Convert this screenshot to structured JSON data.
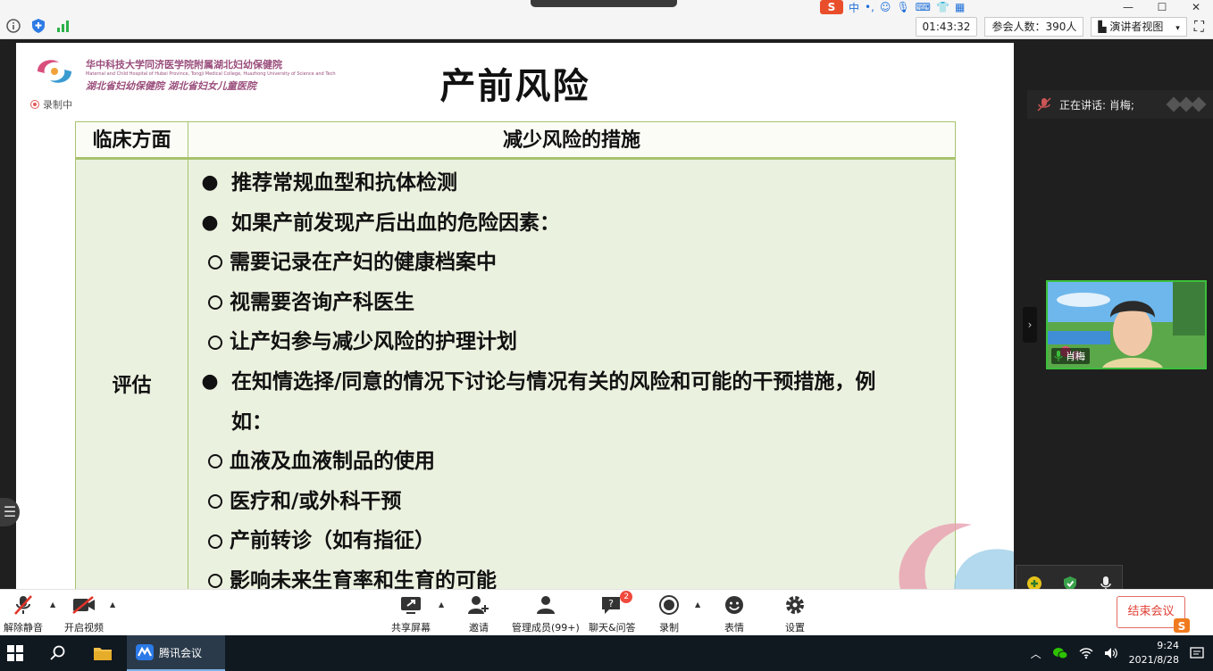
{
  "window": {
    "controls": [
      "—",
      "☐",
      "✕"
    ],
    "timer": "01:43:32",
    "participants": "参会人数：390人",
    "view_mode": "演讲者视图",
    "view_caret": "▾"
  },
  "recording": {
    "label": "录制中"
  },
  "slide": {
    "institution_cn": "华中科技大学同济医学院附属湖北妇幼保健院",
    "institution_en": "Maternal and Child Hospital of Hubei Province, Tongji Medical College, Huazhong University of Science and Technology",
    "institution_cn2": "湖北省妇幼保健院  湖北省妇女儿童医院",
    "title": "产前风险",
    "table": {
      "col1_header": "临床方面",
      "col2_header": "减少风险的措施",
      "row_label": "评估",
      "lines": [
        {
          "type": "bullet",
          "text": "推荐常规血型和抗体检测"
        },
        {
          "type": "bullet",
          "text": "如果产前发现产后出血的危险因素："
        },
        {
          "type": "sub",
          "text": "需要记录在产妇的健康档案中"
        },
        {
          "type": "sub",
          "text": "视需要咨询产科医生"
        },
        {
          "type": "sub",
          "text": "让产妇参与减少风险的护理计划"
        },
        {
          "type": "bullet",
          "text": "在知情选择/同意的情况下讨论与情况有关的风险和可能的干预措施，例"
        },
        {
          "type": "cont",
          "text": "如："
        },
        {
          "type": "sub",
          "text": "血液及血液制品的使用"
        },
        {
          "type": "sub",
          "text": "医疗和/或外科干预"
        },
        {
          "type": "sub",
          "text": "产前转诊（如有指征）"
        },
        {
          "type": "sub",
          "text": "影响未来生育率和生育的可能"
        }
      ],
      "bullet_glyph": "●"
    }
  },
  "speaking": {
    "text": "正在讲话: 肖梅;"
  },
  "video": {
    "name": "肖梅"
  },
  "toolbar": {
    "unmute": "解除静音",
    "start_video": "开启视频",
    "share_screen": "共享屏幕",
    "invite": "邀请",
    "manage_members": "管理成员(99+)",
    "chat_qa": "聊天&问答",
    "chat_badge": "2",
    "record": "录制",
    "reactions": "表情",
    "settings": "设置",
    "end_meeting": "结束会议",
    "caret": "▲"
  },
  "taskbar": {
    "app_label": "腾讯会议",
    "time": "9:24",
    "date": "2021/8/28"
  },
  "ime": {
    "logo": "S",
    "mode": "中"
  },
  "colors": {
    "table_border": "#a7c36e",
    "table_fill": "#ebf1df",
    "speaking_green": "#3bbf3b",
    "end_red": "#e04035",
    "taskbar": "#101820"
  }
}
